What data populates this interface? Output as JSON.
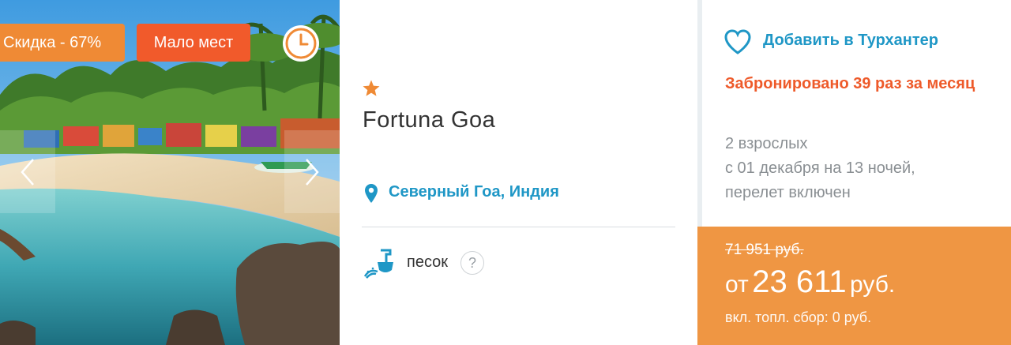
{
  "photo": {
    "badges": {
      "discount": "Скидка - 67%",
      "few_places": "Мало мест"
    },
    "icons": [
      "clock-icon",
      "chevron-left-icon",
      "chevron-right-icon"
    ]
  },
  "hotel": {
    "stars": 1,
    "name": "Fortuna Goa",
    "location": "Северный Гоа, Индия",
    "beach_type": "песок",
    "help_symbol": "?"
  },
  "side": {
    "add_to_favorites": "Добавить в Турхантер",
    "booked": "Забронировано 39 раз за месяц",
    "travelers": "2 взрослых",
    "dates": "с 01 декабря на 13 ночей,",
    "flight": "перелет включен"
  },
  "price": {
    "old": "71 951 руб.",
    "prefix": "от",
    "amount": "23 611",
    "currency": "руб.",
    "fee": "вкл. топл. сбор: 0 руб."
  },
  "colors": {
    "discount_badge": "#ef8a35",
    "few_places_badge": "#f15a2b",
    "link_blue": "#1f97c6",
    "booked_red": "#ee5a2a",
    "price_orange": "#ef9643"
  }
}
